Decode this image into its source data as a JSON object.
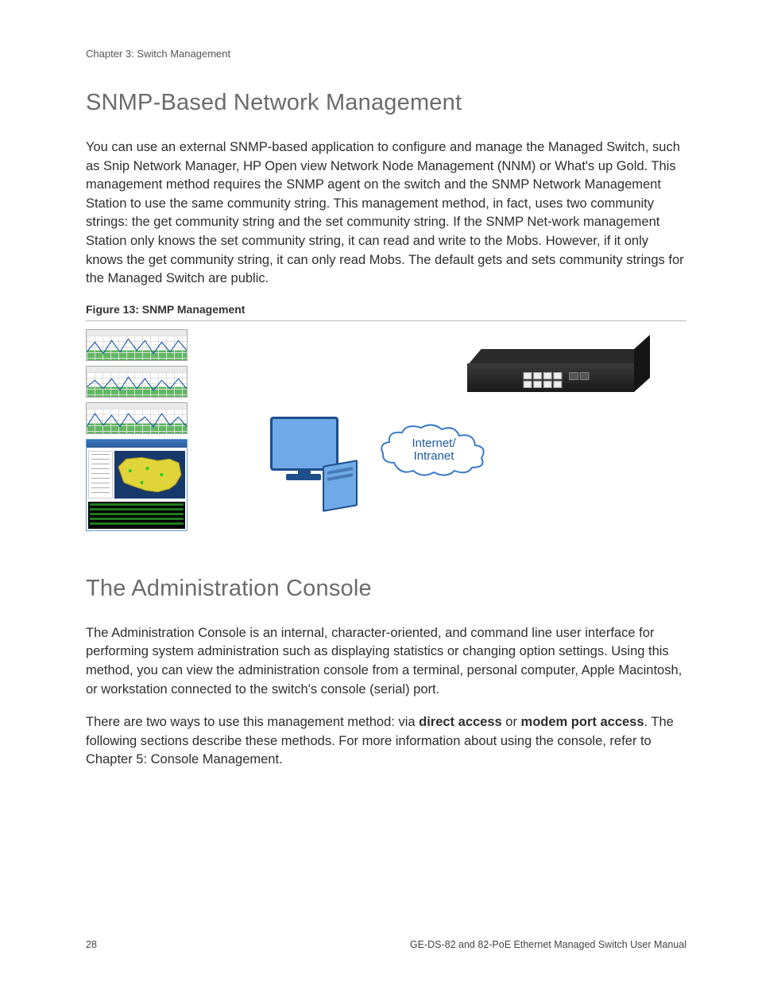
{
  "header": {
    "chapter": "Chapter 3: Switch Management"
  },
  "section1": {
    "heading": "SNMP-Based Network Management",
    "paragraph": "You can use an external SNMP-based application to configure and manage the Managed Switch, such as Snip Network Manager, HP Open view Network Node Management (NNM) or What's up Gold. This management method requires the SNMP agent on the switch and the SNMP Network Management Station to use the same community string. This management method, in fact, uses two community strings: the get community string and the set community string. If the SNMP Net-work management Station only knows the set community string, it can read and write to the Mobs. However, if it only knows the get community string, it can only read Mobs. The default gets and sets community strings for the Managed Switch are public.",
    "figure_caption": "Figure 13: SNMP Management",
    "cloud_line1": "Internet/",
    "cloud_line2": "Intranet"
  },
  "section2": {
    "heading": "The Administration Console",
    "p1": "The Administration Console is an internal, character-oriented, and command line user interface for performing system administration such as displaying statistics or changing option settings. Using this method, you can view the administration console from a terminal, personal computer, Apple Macintosh, or workstation connected to the switch's console (serial) port.",
    "p2_pre": "There are two ways to use this management method: via ",
    "p2_b1": "direct access",
    "p2_mid": " or ",
    "p2_b2": "modem port access",
    "p2_post": ". The following sections describe these methods. For more information about using the console, refer to Chapter 5:  Console Management."
  },
  "footer": {
    "page": "28",
    "doc": "GE-DS-82 and 82-PoE Ethernet Managed Switch User Manual"
  }
}
